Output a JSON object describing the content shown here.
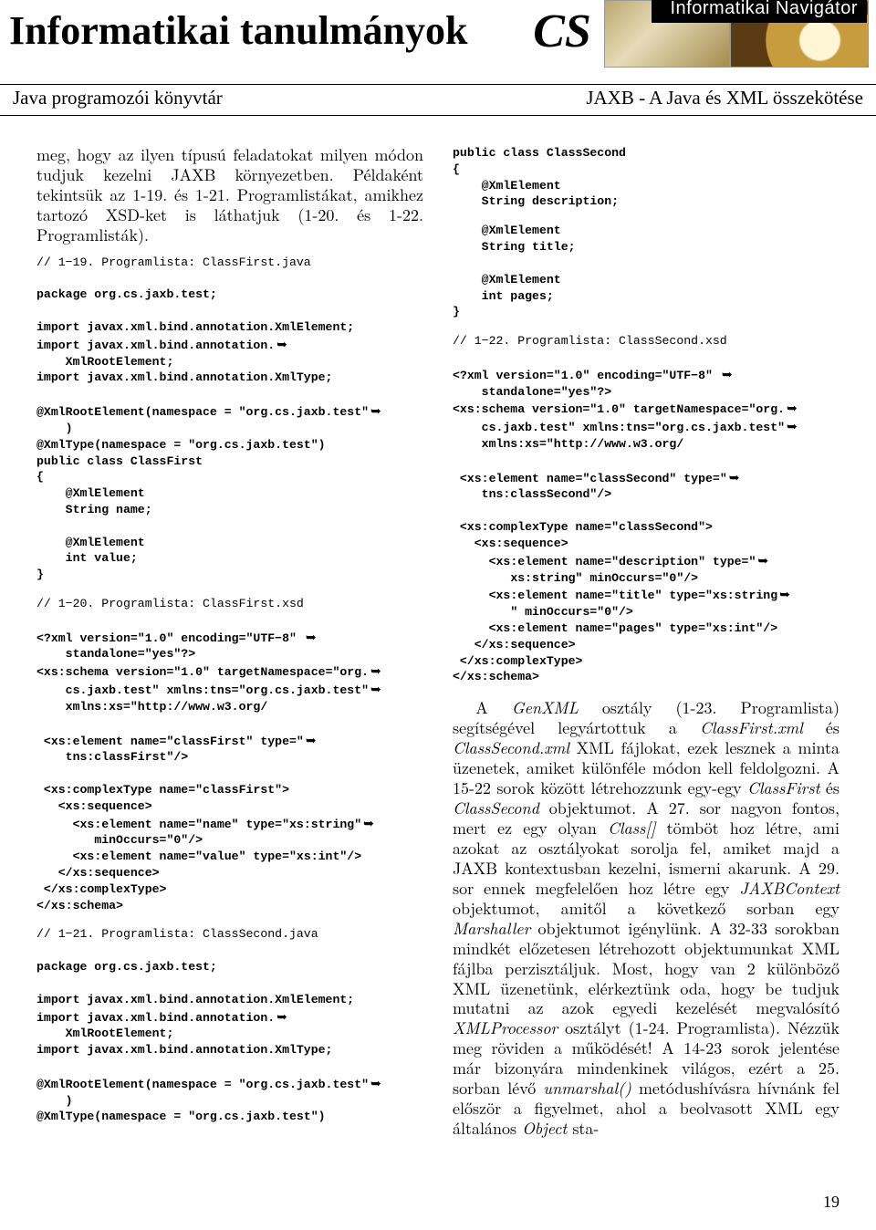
{
  "banner": {
    "title": "Informatikai tanulmányok",
    "logo": "CS",
    "nav": "Informatikai Navigátor"
  },
  "subhead": {
    "left": "Java programozói könyvtár",
    "right": "JAXB - A Java és XML összekötése"
  },
  "para_intro": "meg, hogy az ilyen típusú feladatokat milyen módon tudjuk kezelni JAXB környezetben. Példaként tekintsük az 1-19. és 1-21. Programlistákat, amikhez tartozó XSD-ket is láthatjuk (1-20. és 1-22. Programlisták).",
  "code_19_head": "// 1−19. Programlista: ClassFirst.java",
  "code_19a": "package org.cs.jaxb.test;\n\nimport javax.xml.bind.annotation.XmlElement;\nimport javax.xml.bind.annotation.",
  "code_19a_wrap": "    XmlRootElement;\nimport javax.xml.bind.annotation.XmlType;\n\n@XmlRootElement(namespace = \"org.cs.jaxb.test\"",
  "code_19a_wrap2": "    )\n@XmlType(namespace = \"org.cs.jaxb.test\")\npublic class ClassFirst\n{\n    @XmlElement\n    String name;\n\n    @XmlElement\n    int value;\n}",
  "code_20_head": "// 1−20. Programlista: ClassFirst.xsd",
  "code_20a": "<?xml version=\"1.0\" encoding=\"UTF−8\" ",
  "code_20b": "    standalone=\"yes\"?>\n<xs:schema version=\"1.0\" targetNamespace=\"org.",
  "code_20c": "    cs.jaxb.test\" xmlns:tns=\"org.cs.jaxb.test\"",
  "code_20d": "    xmlns:xs=\"http://www.w3.org/\n\n <xs:element name=\"classFirst\" type=\"",
  "code_20e": "    tns:classFirst\"/>\n\n <xs:complexType name=\"classFirst\">\n   <xs:sequence>\n     <xs:element name=\"name\" type=\"xs:string\"",
  "code_20f": "        minOccurs=\"0\"/>\n     <xs:element name=\"value\" type=\"xs:int\"/>\n   </xs:sequence>\n </xs:complexType>\n</xs:schema>",
  "code_21_head": "// 1−21. Programlista: ClassSecond.java",
  "code_21a": "package org.cs.jaxb.test;\n\nimport javax.xml.bind.annotation.XmlElement;\nimport javax.xml.bind.annotation.",
  "code_21b": "    XmlRootElement;\nimport javax.xml.bind.annotation.XmlType;\n\n@XmlRootElement(namespace = \"org.cs.jaxb.test\"",
  "code_21c": "    )\n@XmlType(namespace = \"org.cs.jaxb.test\")\npublic class ClassSecond\n{\n    @XmlElement\n    String description;",
  "code_col2a": "    @XmlElement\n    String title;\n\n    @XmlElement\n    int pages;\n}",
  "code_22_head": "// 1−22. Programlista: ClassSecond.xsd",
  "code_22a": "<?xml version=\"1.0\" encoding=\"UTF−8\" ",
  "code_22b": "    standalone=\"yes\"?>\n<xs:schema version=\"1.0\" targetNamespace=\"org.",
  "code_22c": "    cs.jaxb.test\" xmlns:tns=\"org.cs.jaxb.test\"",
  "code_22d": "    xmlns:xs=\"http://www.w3.org/\n\n <xs:element name=\"classSecond\" type=\"",
  "code_22e": "    tns:classSecond\"/>\n\n <xs:complexType name=\"classSecond\">\n   <xs:sequence>\n     <xs:element name=\"description\" type=\"",
  "code_22f": "        xs:string\" minOccurs=\"0\"/>\n     <xs:element name=\"title\" type=\"xs:string",
  "code_22g": "        \" minOccurs=\"0\"/>\n     <xs:element name=\"pages\" type=\"xs:int\"/>\n   </xs:sequence>\n </xs:complexType>\n</xs:schema>",
  "para_end_pre": "A ",
  "para_end_em1": "GenXML",
  "para_end_1": " osztály (1-23. Programlista) segítségével legyártottuk a ",
  "para_end_em2": "ClassFirst.xml",
  "para_end_2": " és ",
  "para_end_em3": "ClassSecond.xml",
  "para_end_3": " XML fájlokat, ezek lesznek a minta üzenetek, amiket különféle módon kell feldolgozni. A 15-22 sorok között létrehozzunk egy-egy ",
  "para_end_em4": "ClassFirst",
  "para_end_4": " és ",
  "para_end_em5": "ClassSecond",
  "para_end_5": " objektumot. A 27. sor nagyon fontos, mert ez egy olyan ",
  "para_end_em6": "Class[]",
  "para_end_6": " tömböt hoz létre, ami azokat az osztályokat sorolja fel, amiket majd a JAXB kontextusban kezelni, ismerni akarunk. A 29. sor ennek megfelelően hoz létre egy ",
  "para_end_em7": "JAXBContext",
  "para_end_7": " objektumot, amitől a következő sorban egy ",
  "para_end_em8": "Marshaller",
  "para_end_8": " objektumot igénylünk. A 32-33 sorokban mindkét előzetesen létrehozott objektumunkat XML fájlba perzisztáljuk. Most, hogy van 2 különböző XML üzenetünk, elérkeztünk oda, hogy be tudjuk mutatni az azok egyedi kezelését megvalósító ",
  "para_end_em9": "XMLProcessor",
  "para_end_9": " osztályt (1-24. Programlista). Nézzük meg röviden a működését! A 14-23 sorok jelentése már bizonyára mindenkinek világos, ezért a 25. sorban lévő ",
  "para_end_em10": "unmarshal()",
  "para_end_10": " metódushívásra hívnánk fel először a figyelmet, ahol a beolvasott XML egy általános ",
  "para_end_em11": "Object",
  "para_end_11": " sta-",
  "pagenum": "19"
}
